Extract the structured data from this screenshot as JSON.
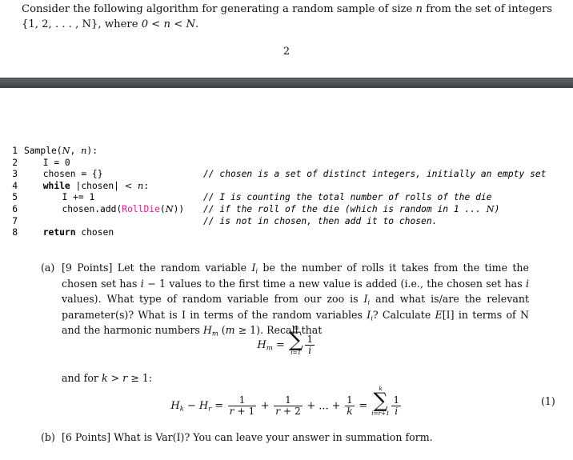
{
  "document": {
    "page_number": "2",
    "intro": {
      "line1_a": "Consider the following algorithm for generating a random sample of size ",
      "intro_n": "n",
      "line1_b": " from the set of integers {1, 2, . . . , N},",
      "line2_a": "where ",
      "line2_math": "0 < n < N",
      "line2_b": "."
    },
    "divider_color": "#4a5053"
  },
  "code": {
    "accent_color": "#ff0aa6",
    "lines": [
      {
        "num": "1",
        "indent": 0,
        "code": "Sample(N, n):",
        "comment": ""
      },
      {
        "num": "2",
        "indent": 1,
        "code": "I = 0",
        "comment": ""
      },
      {
        "num": "3",
        "indent": 1,
        "code": "chosen = {}",
        "comment": "// chosen is a set of distinct integers, initially an empty set"
      },
      {
        "num": "4",
        "indent": 1,
        "code": "while |chosen| < n:",
        "comment": ""
      },
      {
        "num": "5",
        "indent": 2,
        "code": "I += 1",
        "comment": "// I is counting the total number of rolls of the die"
      },
      {
        "num": "6",
        "indent": 2,
        "code": "chosen.add(RollDie(N))",
        "comment": "// if the roll of the die (which is random in 1 ... N)"
      },
      {
        "num": "7",
        "indent": 0,
        "code": "",
        "comment": "// is not in chosen, then add it to chosen."
      },
      {
        "num": "8",
        "indent": 1,
        "code": "return chosen",
        "comment": ""
      }
    ],
    "keywords": [
      "while",
      "return"
    ],
    "function_name": "RollDie"
  },
  "parts": {
    "a": {
      "label": "(a)",
      "points": "[9 Points]",
      "text_1": "Let the random variable ",
      "var_I_i": "I_i",
      "text_2": " be the number of rolls it takes from the time the chosen set has ",
      "imath": "i − 1",
      "text_3": " values to the first time a new value is added (i.e., the chosen set has ",
      "ivar": "i",
      "text_4": " values). What type of random variable from our zoo is ",
      "text_5": " and what is/are the relevant parameter(s)? What is I in terms of the random variables ",
      "text_6": "? Calculate ",
      "expect": "E[I]",
      "text_7": " in terms of N and the harmonic numbers ",
      "hm": "H_m",
      "text_8": " (m ≥ 1). Recall that"
    },
    "and_for": {
      "prefix": "and for ",
      "condition": "k > r ≥ 1",
      "suffix": ":"
    },
    "b": {
      "label": "(b)",
      "points": "[6 Points]",
      "text": "What is Var(I)? You can leave your answer in summation form."
    }
  },
  "equations": {
    "harmonic": {
      "lhs": "H",
      "lhs_sub": "m",
      "eq": "=",
      "sum_top": "m",
      "sum_bottom": "i=1",
      "num": "1",
      "den": "i"
    },
    "hk_minus_hr": {
      "lhs_h": "H",
      "lhs_sub1": "k",
      "minus": "−",
      "lhs_h2": "H",
      "lhs_sub2": "r",
      "eq1": "=",
      "f1_num": "1",
      "f1_den": "r + 2",
      "f1_den_first": "r + 1",
      "plus": "+",
      "dots": "...",
      "fk_num": "1",
      "fk_den": "k",
      "eq2": "=",
      "sum_top": "k",
      "sum_bottom": "i=r+1",
      "sum_num": "1",
      "sum_den": "i",
      "number": "(1)"
    }
  }
}
